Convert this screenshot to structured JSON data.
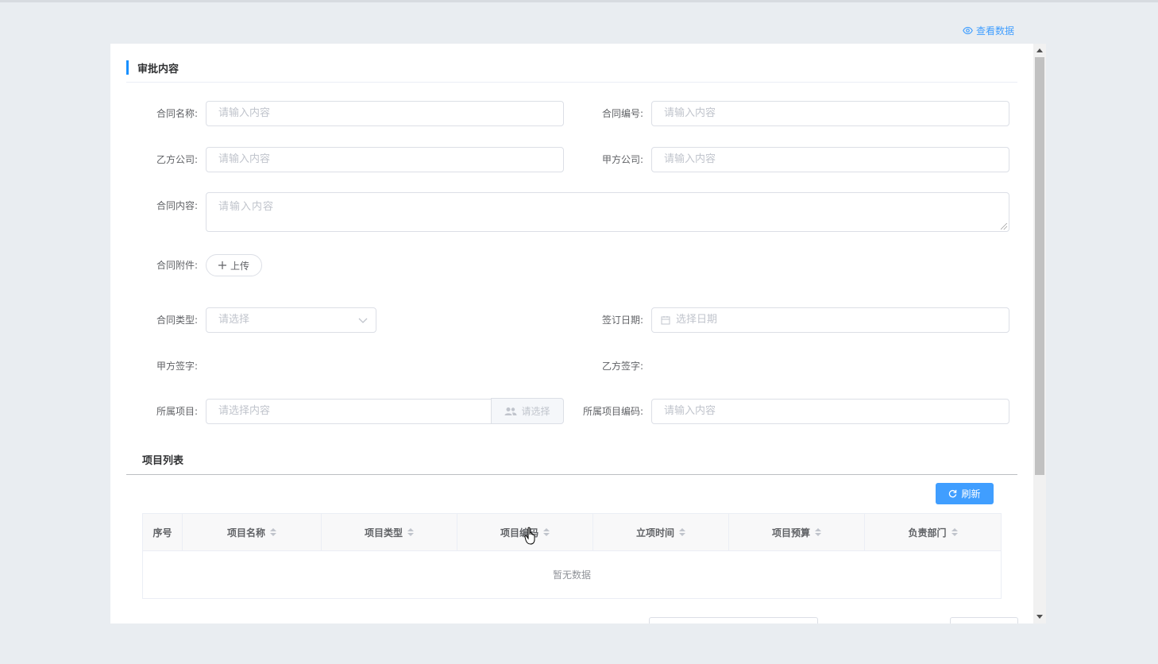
{
  "header": {
    "view_data_label": "查看数据",
    "view_icon": "eye-icon"
  },
  "section": {
    "title": "审批内容"
  },
  "form": {
    "contract_name": {
      "label": "合同名称:",
      "placeholder": "请输入内容"
    },
    "contract_no": {
      "label": "合同编号:",
      "placeholder": "请输入内容"
    },
    "party_b": {
      "label": "乙方公司:",
      "placeholder": "请输入内容"
    },
    "party_a": {
      "label": "甲方公司:",
      "placeholder": "请输入内容"
    },
    "content": {
      "label": "合同内容:",
      "placeholder": "请输入内容"
    },
    "attachment": {
      "label": "合同附件:",
      "button": "上传"
    },
    "type": {
      "label": "合同类型:",
      "placeholder": "请选择"
    },
    "sign_date": {
      "label": "签订日期:",
      "placeholder": "选择日期"
    },
    "party_a_sign": {
      "label": "甲方签字:"
    },
    "party_b_sign": {
      "label": "乙方签字:"
    },
    "project": {
      "label": "所属项目:",
      "placeholder": "请选择内容",
      "button": "请选择"
    },
    "project_code": {
      "label": "所属项目编码:",
      "placeholder": "请输入内容"
    }
  },
  "project_list": {
    "title": "项目列表",
    "refresh_label": "刷新",
    "columns": [
      "序号",
      "项目名称",
      "项目类型",
      "项目编码",
      "立项时间",
      "项目预算",
      "负责部门"
    ],
    "empty_text": "暂无数据"
  },
  "colors": {
    "accent": "#409eff",
    "section_bar": "#1890ff"
  }
}
